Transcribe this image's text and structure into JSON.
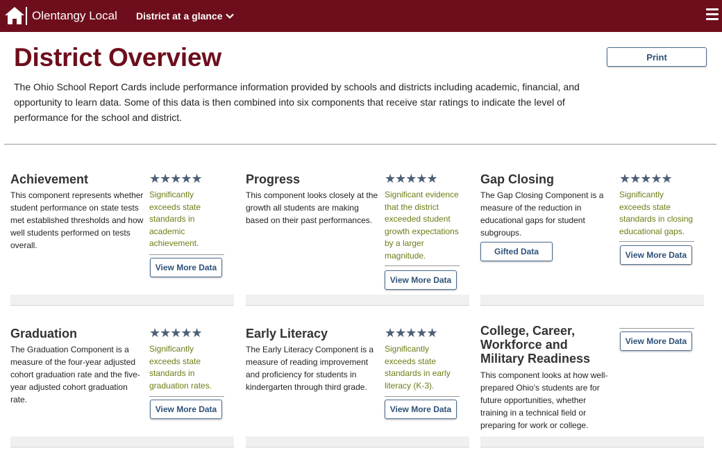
{
  "nav": {
    "site_name": "Olentangy Local",
    "district_menu": "District at a glance"
  },
  "header": {
    "title": "District Overview",
    "print_label": "Print",
    "intro": "The Ohio School Report Cards include performance information provided by schools and districts including academic, financial, and opportunity to learn data. Some of this data is then combined into six components that receive star ratings to indicate the level of performance for the school and district."
  },
  "cards": [
    {
      "name": "Achievement",
      "stars": 5,
      "stars_text": "★★★★★",
      "description": "This component represents whether student performance on state tests met established thresholds and how well students performed on tests overall.",
      "rating": "Significantly exceeds state standards in academic achievement.",
      "button": "View More Data"
    },
    {
      "name": "Progress",
      "stars": 5,
      "stars_text": "★★★★★",
      "description": "This component looks closely at the growth all students are making based on their past performances.",
      "rating": "Significant evidence that the district exceeded student growth expectations by a larger magnitude.",
      "button": "View More Data"
    },
    {
      "name": "Gap Closing",
      "stars": 5,
      "stars_text": "★★★★★",
      "description": "The Gap Closing Component is a measure of the reduction in educational gaps for student subgroups.",
      "rating": "Significantly exceeds state standards in closing educational gaps.",
      "secondary_button": "Gifted Data",
      "button": "View More Data"
    },
    {
      "name": "Graduation",
      "stars": 5,
      "stars_text": "★★★★★",
      "description": "The Graduation Component is a measure of the four-year adjusted cohort graduation rate and the five-year adjusted cohort graduation rate.",
      "rating": "Significantly exceeds state standards in graduation rates.",
      "button": "View More Data"
    },
    {
      "name": "Early Literacy",
      "stars": 5,
      "stars_text": "★★★★★",
      "description": "The Early Literacy Component is a measure of reading improvement and proficiency for students in kindergarten through third grade.",
      "rating": "Significantly exceeds state standards in early literacy (K-3).",
      "button": "View More Data"
    },
    {
      "name": "College, Career, Workforce and Military Readiness",
      "description": "This component looks at how well-prepared Ohio's students are for future opportunities, whether training in a technical field or preparing for work or college.",
      "button": "View More Data"
    }
  ],
  "colors": {
    "brand": "#6e0e1c",
    "star": "#4d5f76",
    "rating_text": "#6b7d16",
    "button_text": "#2d5178"
  }
}
